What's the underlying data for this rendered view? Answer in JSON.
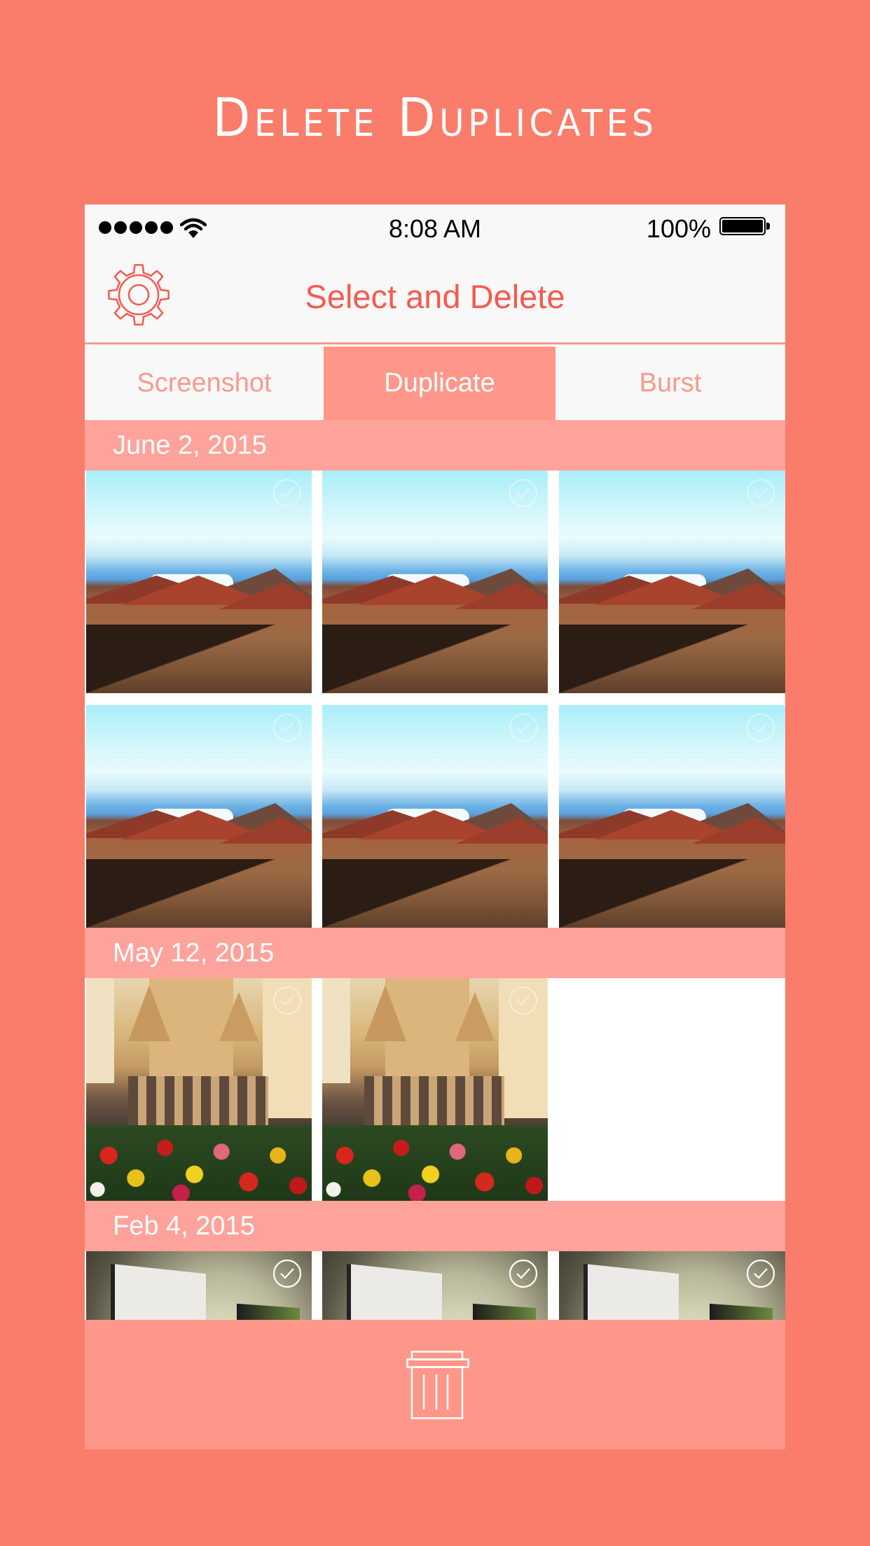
{
  "promo": {
    "title": "Delete Duplicates"
  },
  "status_bar": {
    "signal_icon": "signal-dots-icon",
    "wifi_icon": "wifi-icon",
    "time": "8:08 AM",
    "battery_percent": "100%",
    "battery_icon": "battery-full-icon"
  },
  "navbar": {
    "settings_icon": "gear-icon",
    "title": "Select and Delete"
  },
  "tabs": [
    {
      "label": "Screenshot",
      "active": false
    },
    {
      "label": "Duplicate",
      "active": true
    },
    {
      "label": "Burst",
      "active": false
    }
  ],
  "sections": [
    {
      "date": "June 2, 2015",
      "photos": [
        {
          "subject": "volcanic landscape",
          "checked": false
        },
        {
          "subject": "volcanic landscape",
          "checked": false
        },
        {
          "subject": "volcanic landscape",
          "checked": false
        },
        {
          "subject": "volcanic landscape",
          "checked": false
        },
        {
          "subject": "volcanic landscape",
          "checked": false
        },
        {
          "subject": "volcanic landscape",
          "checked": false
        }
      ]
    },
    {
      "date": "May 12, 2015",
      "photos": [
        {
          "subject": "church with tulips",
          "checked": false
        },
        {
          "subject": "church with tulips",
          "checked": false
        }
      ]
    },
    {
      "date": "Feb 4, 2015",
      "photos": [
        {
          "subject": "gallery wall",
          "checked": true
        },
        {
          "subject": "gallery wall",
          "checked": true
        },
        {
          "subject": "gallery wall",
          "checked": true
        }
      ]
    }
  ],
  "bottom_bar": {
    "delete_icon": "trash-icon"
  },
  "colors": {
    "background": "#f97d6a",
    "accent_red": "#f55a4e",
    "active_tab": "#fe978a",
    "date_header": "#fea39b",
    "inactive_tab_text": "#f69a8c",
    "bar_light": "#f8f8f8"
  }
}
